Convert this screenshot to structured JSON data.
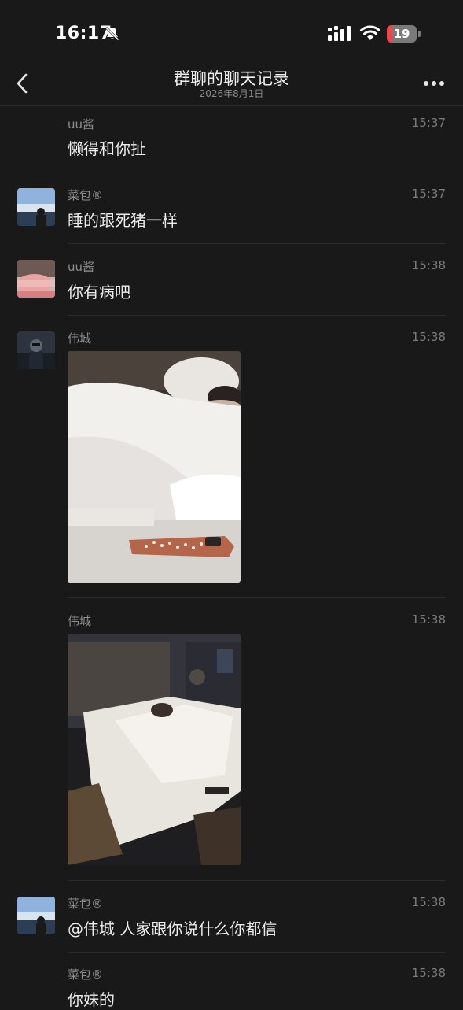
{
  "status_bar": {
    "time": "16:17",
    "battery": "19",
    "icons": [
      "bell-slash-icon",
      "signal-icon",
      "wifi-icon",
      "battery-icon"
    ]
  },
  "nav": {
    "title": "群聊的聊天记录",
    "subtitle": "2026年8月1日",
    "back_icon": "chevron-left-icon",
    "more_icon": "ellipsis-icon"
  },
  "messages": [
    {
      "sender": "uu酱",
      "time": "15:37",
      "text": "懒得和你扯"
    },
    {
      "sender": "菜包®",
      "time": "15:37",
      "text": "睡的跟死猪一样"
    },
    {
      "sender": "uu酱",
      "time": "15:38",
      "text": "你有病吧"
    },
    {
      "sender": "伟城",
      "time": "15:38",
      "type": "image"
    },
    {
      "sender": "伟城",
      "time": "15:38",
      "type": "image"
    },
    {
      "sender": "菜包®",
      "time": "15:38",
      "text": "@伟城 人家跟你说什么你都信"
    },
    {
      "sender": "菜包®",
      "time": "15:38",
      "text": "你妹的"
    }
  ],
  "colors": {
    "background": "#191919",
    "text": "#ececec",
    "secondary_text": "#8f8f8f",
    "battery_low": "#e5484d"
  }
}
